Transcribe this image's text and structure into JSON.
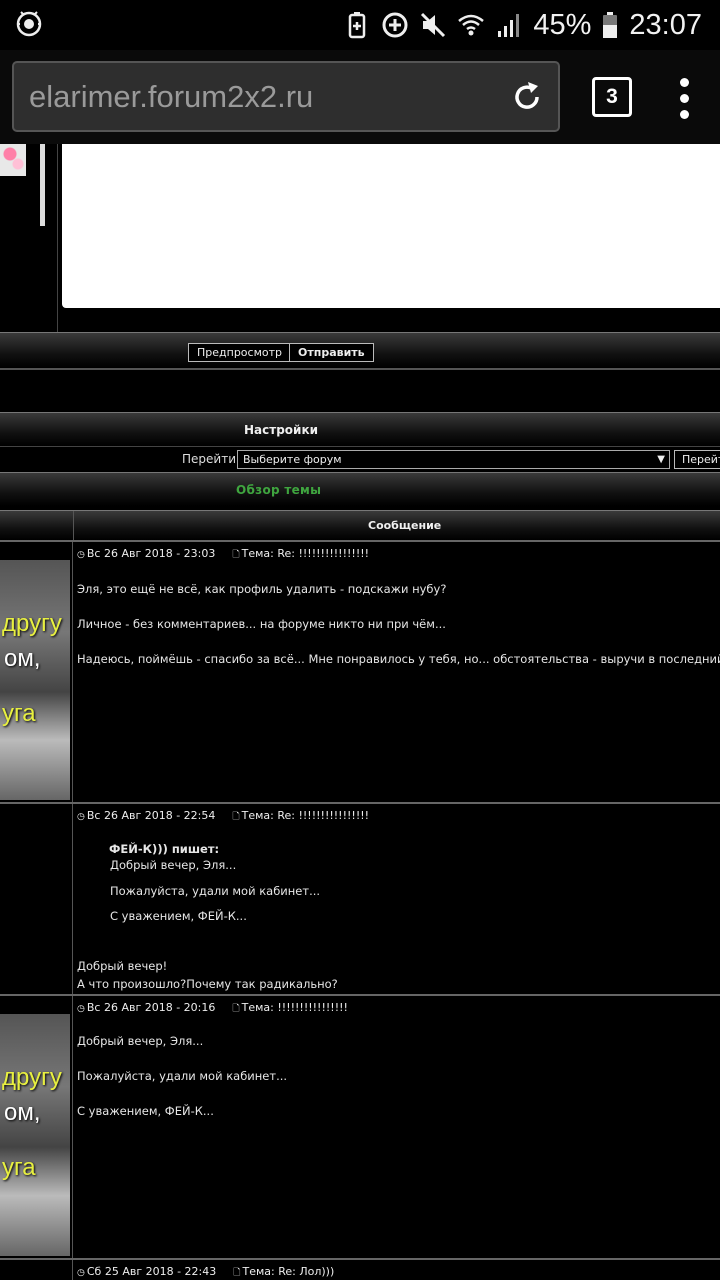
{
  "status_bar": {
    "battery_percent": "45%",
    "time": "23:07",
    "icons": [
      "dr-web-icon",
      "battery-saver-icon",
      "data-saver-icon",
      "mute-icon",
      "wifi-icon",
      "signal-icon",
      "battery-icon"
    ]
  },
  "browser": {
    "url": "elarimer.forum2x2.ru",
    "tab_count": "3"
  },
  "reply_form": {
    "preview_label": "Предпросмотр",
    "submit_label": "Отправить"
  },
  "settings_header": "Настройки",
  "jump": {
    "label": "Перейти:",
    "select_value": "Выберите форум",
    "go_label": "Перейт"
  },
  "topic_overview_header": "Обзор темы",
  "table_header": {
    "message": "Сообщение"
  },
  "posts": [
    {
      "date": "Вс 26 Авг 2018 - 23:03",
      "subject": "Тема: Re: !!!!!!!!!!!!!!!!",
      "lines": [
        "Эля, это ещё не всё, как профиль удалить - подскажи нубу?",
        "Личное - без комментариев... на форуме никто ни при чём...",
        "Надеюсь, поймёшь - спасибо за всё... Мне понравилось у тебя, но... обстоятельства - выручи в последний раз..."
      ],
      "avatar_text": [
        "другу",
        "ом,",
        "уга"
      ]
    },
    {
      "date": "Вс 26 Авг 2018 - 22:54",
      "subject": "Тема: Re: !!!!!!!!!!!!!!!!",
      "quote": {
        "author": "ФЕЙ-К))) пишет:",
        "lines": [
          "Добрый вечер, Эля...",
          "Пожалуйста, удали мой кабинет...",
          "С уважением, ФЕЙ-К..."
        ]
      },
      "lines": [
        "Добрый вечер!",
        "А что произошло?Почему так радикально?"
      ]
    },
    {
      "date": "Вс 26 Авг 2018 - 20:16",
      "subject": "Тема: !!!!!!!!!!!!!!!!",
      "lines": [
        "Добрый вечер, Эля...",
        "Пожалуйста, удали мой кабинет...",
        "С уважением, ФЕЙ-К..."
      ],
      "avatar_text": [
        "другу",
        "ом,",
        "уга"
      ]
    },
    {
      "date": "Сб 25 Авг 2018 - 22:43",
      "subject": "Тема: Re: Лол)))",
      "lines": []
    }
  ]
}
